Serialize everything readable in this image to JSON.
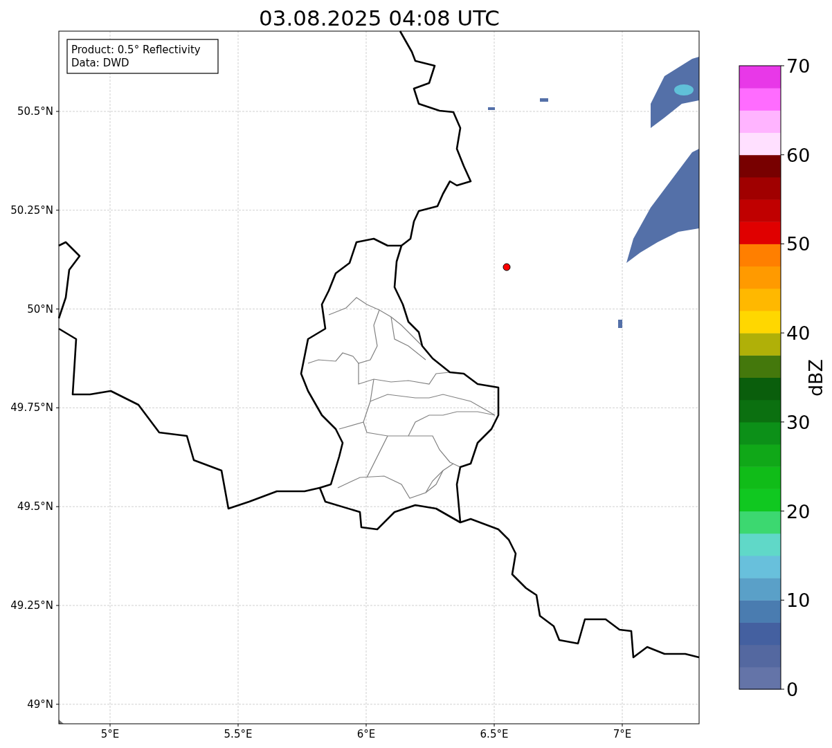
{
  "title": "03.08.2025 04:08 UTC",
  "info_box": [
    "Product: 0.5° Reflectivity",
    "Data: DWD"
  ],
  "map": {
    "x_ticks": [
      "5°E",
      "5.5°E",
      "6°E",
      "6.5°E",
      "7°E"
    ],
    "y_ticks": [
      "50.5°N",
      "50.25°N",
      "50°N",
      "49.75°N",
      "49.5°N",
      "49.25°N",
      "49°N"
    ]
  },
  "colorbar": {
    "label": "dBZ",
    "ticks": [
      "70",
      "60",
      "50",
      "40",
      "30",
      "20",
      "10",
      "0"
    ],
    "bands": [
      {
        "color": "#6474a8"
      },
      {
        "color": "#5468a0"
      },
      {
        "color": "#4460a0"
      },
      {
        "color": "#4a7cb0"
      },
      {
        "color": "#5aa0c8"
      },
      {
        "color": "#68c0dc"
      },
      {
        "color": "#60d8c8"
      },
      {
        "color": "#3cd870"
      },
      {
        "color": "#10c820"
      },
      {
        "color": "#10bc18"
      },
      {
        "color": "#10a818"
      },
      {
        "color": "#0c9018"
      },
      {
        "color": "#0b7010"
      },
      {
        "color": "#0a5e0c"
      },
      {
        "color": "#44780c"
      },
      {
        "color": "#b0b008"
      },
      {
        "color": "#ffd700"
      },
      {
        "color": "#ffb800"
      },
      {
        "color": "#ff9a00"
      },
      {
        "color": "#ff7f00"
      },
      {
        "color": "#e00000"
      },
      {
        "color": "#c00000"
      },
      {
        "color": "#a00000"
      },
      {
        "color": "#780000"
      },
      {
        "color": "#ffe0ff"
      },
      {
        "color": "#ffb4ff"
      },
      {
        "color": "#ff6cff"
      },
      {
        "color": "#e838e8"
      }
    ]
  }
}
